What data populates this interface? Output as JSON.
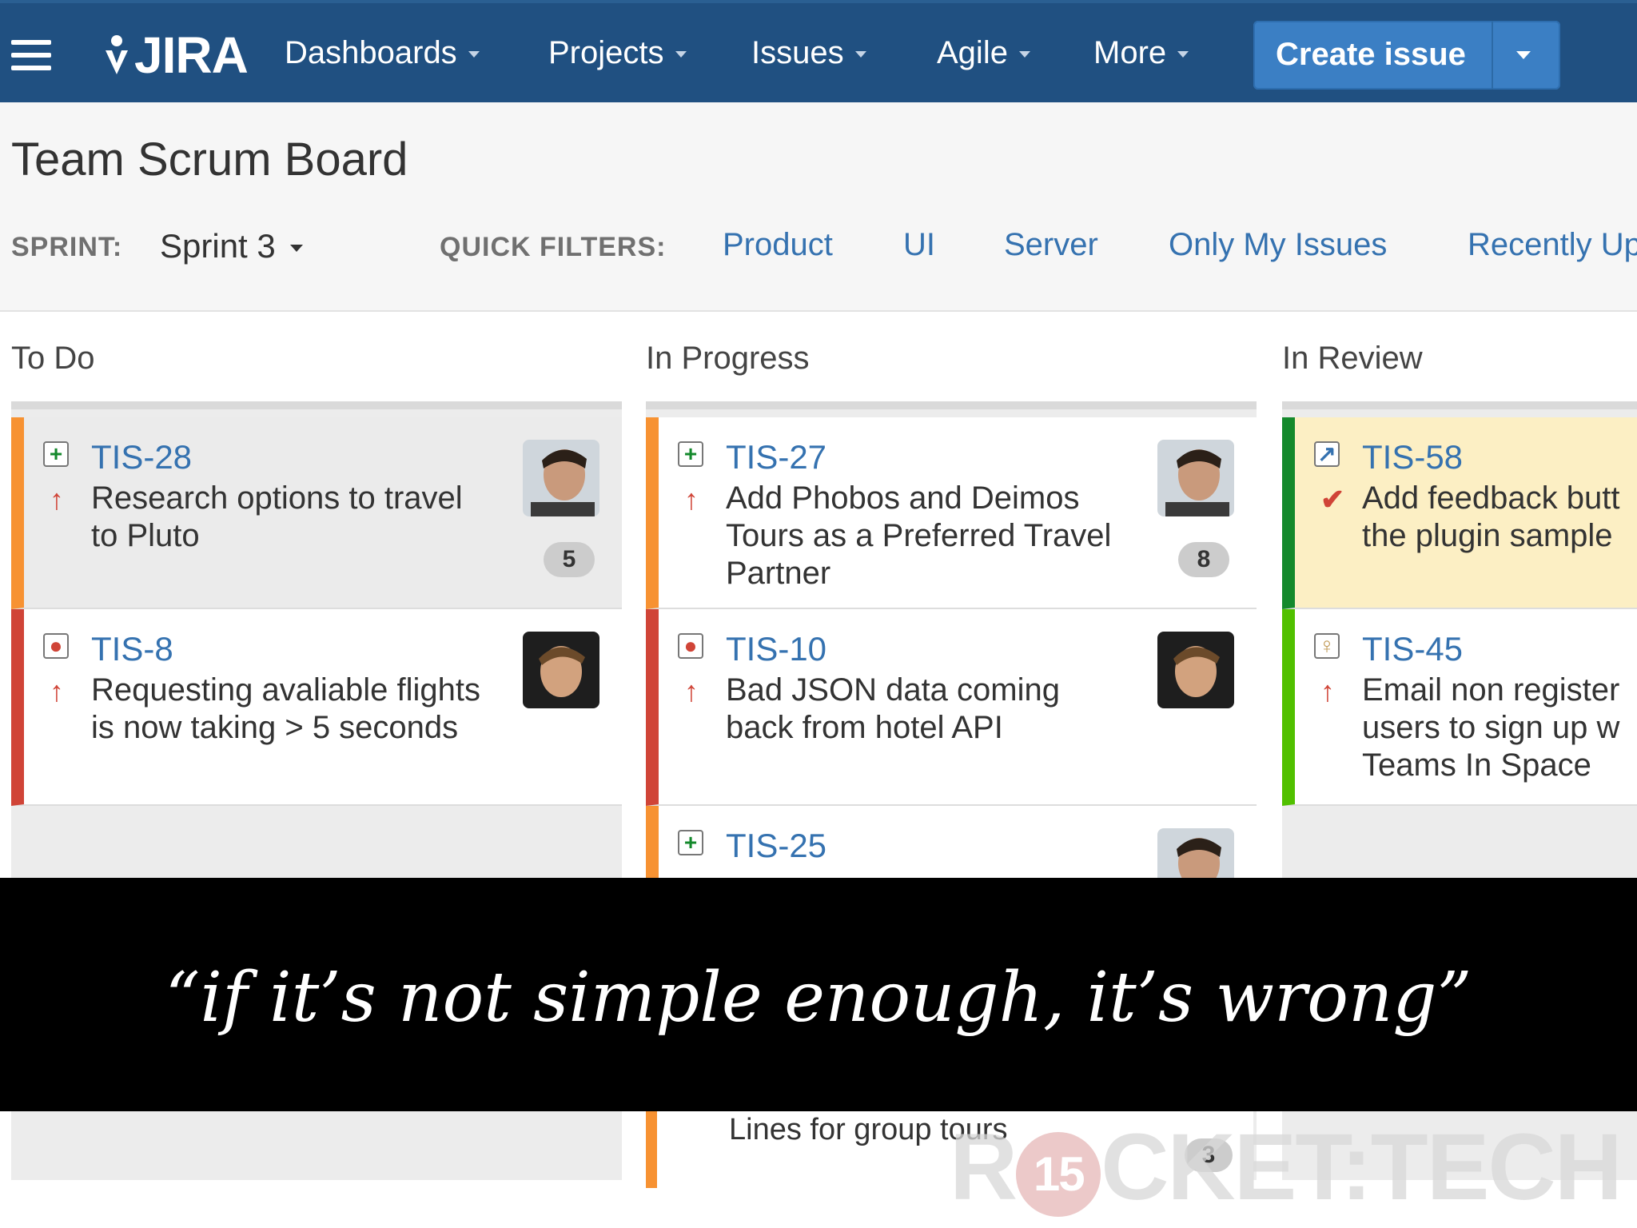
{
  "nav": {
    "logo": "JIRA",
    "items": [
      {
        "label": "Dashboards"
      },
      {
        "label": "Projects"
      },
      {
        "label": "Issues"
      },
      {
        "label": "Agile"
      },
      {
        "label": "More"
      }
    ],
    "create_label": "Create issue"
  },
  "header": {
    "title": "Team Scrum Board",
    "sprint_label": "SPRINT:",
    "sprint_value": "Sprint 3",
    "quick_filters_label": "QUICK FILTERS:",
    "quick_filters": [
      "Product",
      "UI",
      "Server",
      "Only My Issues",
      "Recently Up"
    ]
  },
  "columns": [
    {
      "name": "To Do",
      "cards": [
        {
          "key": "TIS-28",
          "summary": "Research options to travel to Pluto",
          "type": "story-icon",
          "priority": "high-priority-icon",
          "badge": "5",
          "color": "#f79232"
        },
        {
          "key": "TIS-8",
          "summary": "Requesting avaliable flights is now taking > 5 seconds",
          "type": "bug-icon",
          "priority": "high-priority-icon",
          "badge": "",
          "color": "#d04437"
        }
      ]
    },
    {
      "name": "In Progress",
      "cards": [
        {
          "key": "TIS-27",
          "summary": "Add Phobos and Deimos Tours as a Preferred Travel Partner",
          "type": "story-icon",
          "priority": "high-priority-icon",
          "badge": "8",
          "color": "#f79232"
        },
        {
          "key": "TIS-10",
          "summary": "Bad JSON data coming back from hotel API",
          "type": "bug-icon",
          "priority": "high-priority-icon",
          "badge": "",
          "color": "#d04437"
        },
        {
          "key": "TIS-25",
          "summary": "",
          "type": "story-icon",
          "priority": "high-priority-icon",
          "badge": "",
          "color": "#f79232"
        }
      ],
      "bottom_card": {
        "summary": "Lines for group tours",
        "badge": "3"
      }
    },
    {
      "name": "In Review",
      "cards": [
        {
          "key": "TIS-58",
          "summary": "Add feedback butt the plugin sample",
          "type": "task-icon",
          "priority": "blocker-priority-icon",
          "badge": "",
          "color": "#14892c"
        },
        {
          "key": "TIS-45",
          "summary": "Email non register users to sign up w Teams In Space",
          "type": "idea-icon",
          "priority": "high-priority-icon",
          "badge": "",
          "color": "#51c000"
        }
      ]
    }
  ],
  "overlay": {
    "quote": "“if it’s not simple enough, it’s wrong”"
  },
  "watermark": {
    "left": "R",
    "disc": "15",
    "right": "CKET:TECH"
  }
}
